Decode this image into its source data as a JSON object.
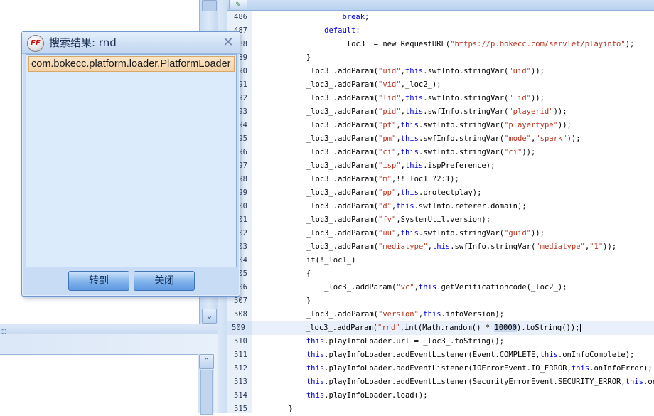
{
  "dialog": {
    "title": "搜索结果: rnd",
    "app_icon": "ffdec-logo-icon",
    "close_glyph": "✕",
    "results": [
      "com.bokecc.platform.loader.PlatformLoader"
    ],
    "buttons": {
      "goto": "转到",
      "close": "关闭"
    }
  },
  "editor": {
    "line_numbers": [
      "486",
      "487",
      "488",
      "489",
      "490",
      "491",
      "492",
      "493",
      "494",
      "495",
      "496",
      "497",
      "498",
      "499",
      "500",
      "501",
      "502",
      "503",
      "504",
      "505",
      "506",
      "507",
      "508",
      "509",
      "510",
      "511",
      "512",
      "513",
      "514",
      "515"
    ],
    "current_line": "509",
    "lines": [
      [
        {
          "t": "                    "
        },
        {
          "t": "break",
          "c": "kw"
        },
        {
          "t": ";"
        }
      ],
      [
        {
          "t": "                "
        },
        {
          "t": "default",
          "c": "kw"
        },
        {
          "t": ":"
        }
      ],
      [
        {
          "t": "                    _loc3_ = new RequestURL("
        },
        {
          "t": "\"https://p.bokecc.com/servlet/playinfo\"",
          "c": "str"
        },
        {
          "t": ");"
        }
      ],
      [
        {
          "t": "            }"
        }
      ],
      [
        {
          "t": "            _loc3_.addParam("
        },
        {
          "t": "\"uid\"",
          "c": "str"
        },
        {
          "t": ","
        },
        {
          "t": "this",
          "c": "kw"
        },
        {
          "t": ".swfInfo.stringVar("
        },
        {
          "t": "\"uid\"",
          "c": "str"
        },
        {
          "t": "));"
        }
      ],
      [
        {
          "t": "            _loc3_.addParam("
        },
        {
          "t": "\"vid\"",
          "c": "str"
        },
        {
          "t": ",_loc2_);"
        }
      ],
      [
        {
          "t": "            _loc3_.addParam("
        },
        {
          "t": "\"lid\"",
          "c": "str"
        },
        {
          "t": ","
        },
        {
          "t": "this",
          "c": "kw"
        },
        {
          "t": ".swfInfo.stringVar("
        },
        {
          "t": "\"lid\"",
          "c": "str"
        },
        {
          "t": "));"
        }
      ],
      [
        {
          "t": "            _loc3_.addParam("
        },
        {
          "t": "\"pid\"",
          "c": "str"
        },
        {
          "t": ","
        },
        {
          "t": "this",
          "c": "kw"
        },
        {
          "t": ".swfInfo.stringVar("
        },
        {
          "t": "\"playerid\"",
          "c": "str"
        },
        {
          "t": "));"
        }
      ],
      [
        {
          "t": "            _loc3_.addParam("
        },
        {
          "t": "\"pt\"",
          "c": "str"
        },
        {
          "t": ","
        },
        {
          "t": "this",
          "c": "kw"
        },
        {
          "t": ".swfInfo.stringVar("
        },
        {
          "t": "\"playertype\"",
          "c": "str"
        },
        {
          "t": "));"
        }
      ],
      [
        {
          "t": "            _loc3_.addParam("
        },
        {
          "t": "\"pm\"",
          "c": "str"
        },
        {
          "t": ","
        },
        {
          "t": "this",
          "c": "kw"
        },
        {
          "t": ".swfInfo.stringVar("
        },
        {
          "t": "\"mode\"",
          "c": "str"
        },
        {
          "t": ","
        },
        {
          "t": "\"spark\"",
          "c": "str"
        },
        {
          "t": "));"
        }
      ],
      [
        {
          "t": "            _loc3_.addParam("
        },
        {
          "t": "\"ci\"",
          "c": "str"
        },
        {
          "t": ","
        },
        {
          "t": "this",
          "c": "kw"
        },
        {
          "t": ".swfInfo.stringVar("
        },
        {
          "t": "\"ci\"",
          "c": "str"
        },
        {
          "t": "));"
        }
      ],
      [
        {
          "t": "            _loc3_.addParam("
        },
        {
          "t": "\"isp\"",
          "c": "str"
        },
        {
          "t": ","
        },
        {
          "t": "this",
          "c": "kw"
        },
        {
          "t": ".ispPreference);"
        }
      ],
      [
        {
          "t": "            _loc3_.addParam("
        },
        {
          "t": "\"m\"",
          "c": "str"
        },
        {
          "t": ",!!_loc1_?2:1);"
        }
      ],
      [
        {
          "t": "            _loc3_.addParam("
        },
        {
          "t": "\"pp\"",
          "c": "str"
        },
        {
          "t": ","
        },
        {
          "t": "this",
          "c": "kw"
        },
        {
          "t": ".protectplay);"
        }
      ],
      [
        {
          "t": "            _loc3_.addParam("
        },
        {
          "t": "\"d\"",
          "c": "str"
        },
        {
          "t": ","
        },
        {
          "t": "this",
          "c": "kw"
        },
        {
          "t": ".swfInfo.referer.domain);"
        }
      ],
      [
        {
          "t": "            _loc3_.addParam("
        },
        {
          "t": "\"fv\"",
          "c": "str"
        },
        {
          "t": ",SystemUtil.version);"
        }
      ],
      [
        {
          "t": "            _loc3_.addParam("
        },
        {
          "t": "\"uu\"",
          "c": "str"
        },
        {
          "t": ","
        },
        {
          "t": "this",
          "c": "kw"
        },
        {
          "t": ".swfInfo.stringVar("
        },
        {
          "t": "\"guid\"",
          "c": "str"
        },
        {
          "t": "));"
        }
      ],
      [
        {
          "t": "            _loc3_.addParam("
        },
        {
          "t": "\"mediatype\"",
          "c": "str"
        },
        {
          "t": ","
        },
        {
          "t": "this",
          "c": "kw"
        },
        {
          "t": ".swfInfo.stringVar("
        },
        {
          "t": "\"mediatype\"",
          "c": "str"
        },
        {
          "t": ","
        },
        {
          "t": "\"1\"",
          "c": "str"
        },
        {
          "t": "));"
        }
      ],
      [
        {
          "t": "            if(!_loc1_)"
        }
      ],
      [
        {
          "t": "            {"
        }
      ],
      [
        {
          "t": "                _loc3_.addParam("
        },
        {
          "t": "\"vc\"",
          "c": "str"
        },
        {
          "t": ","
        },
        {
          "t": "this",
          "c": "kw"
        },
        {
          "t": ".getVerificationcode(_loc2_);"
        }
      ],
      [
        {
          "t": "            }"
        }
      ],
      [
        {
          "t": "            _loc3_.addParam("
        },
        {
          "t": "\"version\"",
          "c": "str"
        },
        {
          "t": ","
        },
        {
          "t": "this",
          "c": "kw"
        },
        {
          "t": ".infoVersion);"
        }
      ],
      [
        {
          "t": "            _loc3_.addParam("
        },
        {
          "t": "\"rnd\"",
          "c": "str"
        },
        {
          "t": ",int(Math.random() * "
        },
        {
          "t": "10000",
          "c": "num"
        },
        {
          "t": ").toString());"
        }
      ],
      [
        {
          "t": "            "
        },
        {
          "t": "this",
          "c": "kw"
        },
        {
          "t": ".playInfoLoader.url = _loc3_.toString();"
        }
      ],
      [
        {
          "t": "            "
        },
        {
          "t": "this",
          "c": "kw"
        },
        {
          "t": ".playInfoLoader.addEventListener(Event.COMPLETE,"
        },
        {
          "t": "this",
          "c": "kw"
        },
        {
          "t": ".onInfoComplete);"
        }
      ],
      [
        {
          "t": "            "
        },
        {
          "t": "this",
          "c": "kw"
        },
        {
          "t": ".playInfoLoader.addEventListener(IOErrorEvent.IO_ERROR,"
        },
        {
          "t": "this",
          "c": "kw"
        },
        {
          "t": ".onInfoError);"
        }
      ],
      [
        {
          "t": "            "
        },
        {
          "t": "this",
          "c": "kw"
        },
        {
          "t": ".playInfoLoader.addEventListener(SecurityErrorEvent.SECURITY_ERROR,"
        },
        {
          "t": "this",
          "c": "kw"
        },
        {
          "t": ".onInfoError);"
        }
      ],
      [
        {
          "t": "            "
        },
        {
          "t": "this",
          "c": "kw"
        },
        {
          "t": ".playInfoLoader.load();"
        }
      ],
      [
        {
          "t": "        }"
        }
      ]
    ]
  },
  "colors": {
    "keyword": "#0000e6",
    "string": "#b8331e",
    "number_highlight": "#c8d8f0"
  }
}
